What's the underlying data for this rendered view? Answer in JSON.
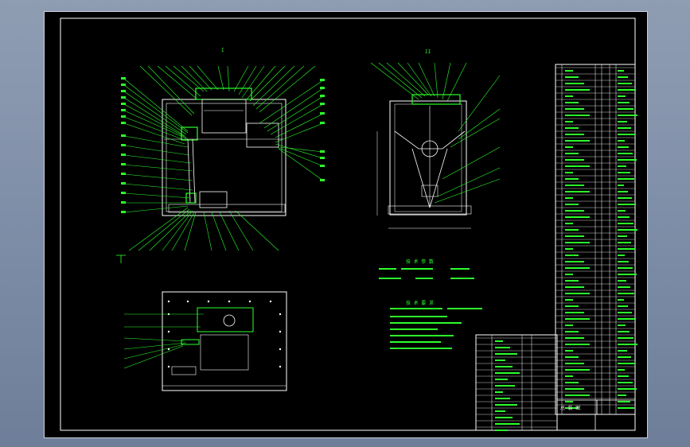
{
  "app": {
    "background_color": "#8596b0",
    "canvas_color": "#000000",
    "line_color_primary": "#2cff2c",
    "line_color_secondary": "#ffffff"
  },
  "drawing": {
    "front_view_label": "I",
    "side_view_label": "II",
    "spec_heading": "技 术 参 数",
    "req_heading": "技 术 要 求",
    "title_name": "总 装 图"
  }
}
